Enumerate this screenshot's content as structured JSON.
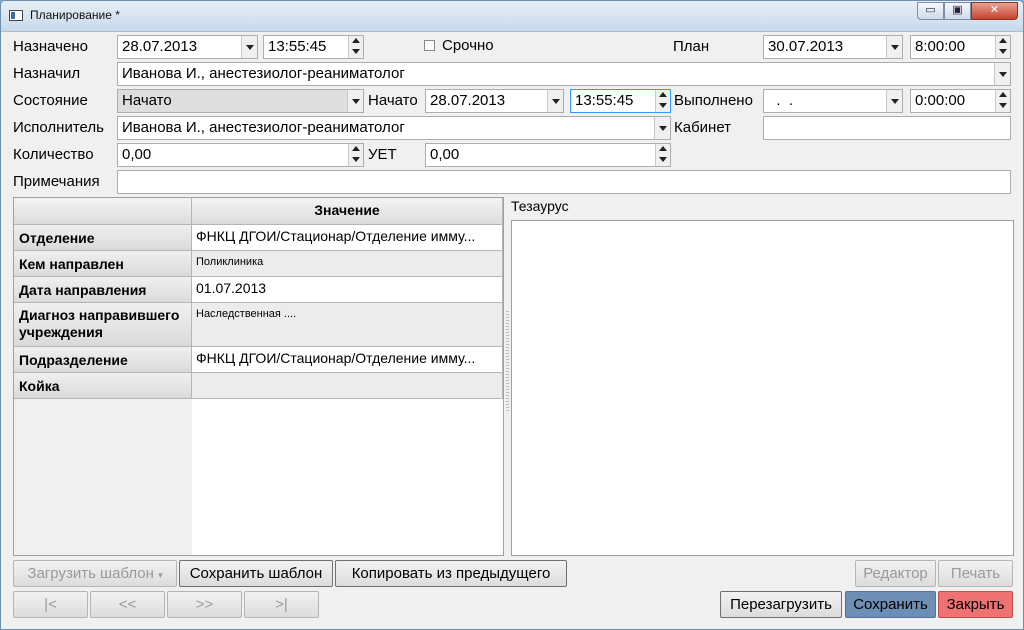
{
  "window": {
    "title": "Планирование *",
    "min_glyph": "▭",
    "max_glyph": "▣",
    "close_glyph": "✕"
  },
  "form": {
    "assigned_label": "Назначено",
    "assigned_date": "28.07.2013",
    "assigned_time": "13:55:45",
    "urgent_label": "Срочно",
    "plan_label": "План",
    "plan_date": "30.07.2013",
    "plan_time": "8:00:00",
    "assigned_by_label": "Назначил",
    "assigned_by": "Иванова И., анестезиолог-реаниматолог",
    "state_label": "Состояние",
    "state": "Начато",
    "started_label": "Начато",
    "started_date": "28.07.2013",
    "started_time": "13:55:45",
    "done_label": "Выполнено",
    "done_date": "  .  .",
    "done_time": "0:00:00",
    "executor_label": "Исполнитель",
    "executor": "Иванова И., анестезиолог-реаниматолог",
    "cabinet_label": "Кабинет",
    "cabinet": "",
    "quantity_label": "Количество",
    "quantity": "0,00",
    "uet_label": "УЕТ",
    "uet": "0,00",
    "notes_label": "Примечания",
    "notes": ""
  },
  "grid": {
    "header": "Значение",
    "rows": [
      {
        "label": "Отделение",
        "value": "ФНКЦ ДГОИ/Стационар/Отделение имму..."
      },
      {
        "label": "Кем направлен",
        "value": "Поликлиника"
      },
      {
        "label": "Дата направления",
        "value": "01.07.2013"
      },
      {
        "label": "Диагноз направившего",
        "label2": "учреждения",
        "value": "Наследственная ...."
      },
      {
        "label": "Подразделение",
        "value": "ФНКЦ ДГОИ/Стационар/Отделение имму..."
      },
      {
        "label": "Койка",
        "value": ""
      }
    ]
  },
  "thesaurus": {
    "label": "Тезаурус"
  },
  "buttons": {
    "load_template": "Загрузить шаблон",
    "save_template": "Сохранить шаблон",
    "copy_prev": "Копировать из предыдущего",
    "editor": "Редактор",
    "print": "Печать",
    "first": "|<",
    "prev": "<<",
    "next": ">>",
    "last": ">|",
    "reload": "Перезагрузить",
    "save": "Сохранить",
    "close": "Закрыть"
  }
}
